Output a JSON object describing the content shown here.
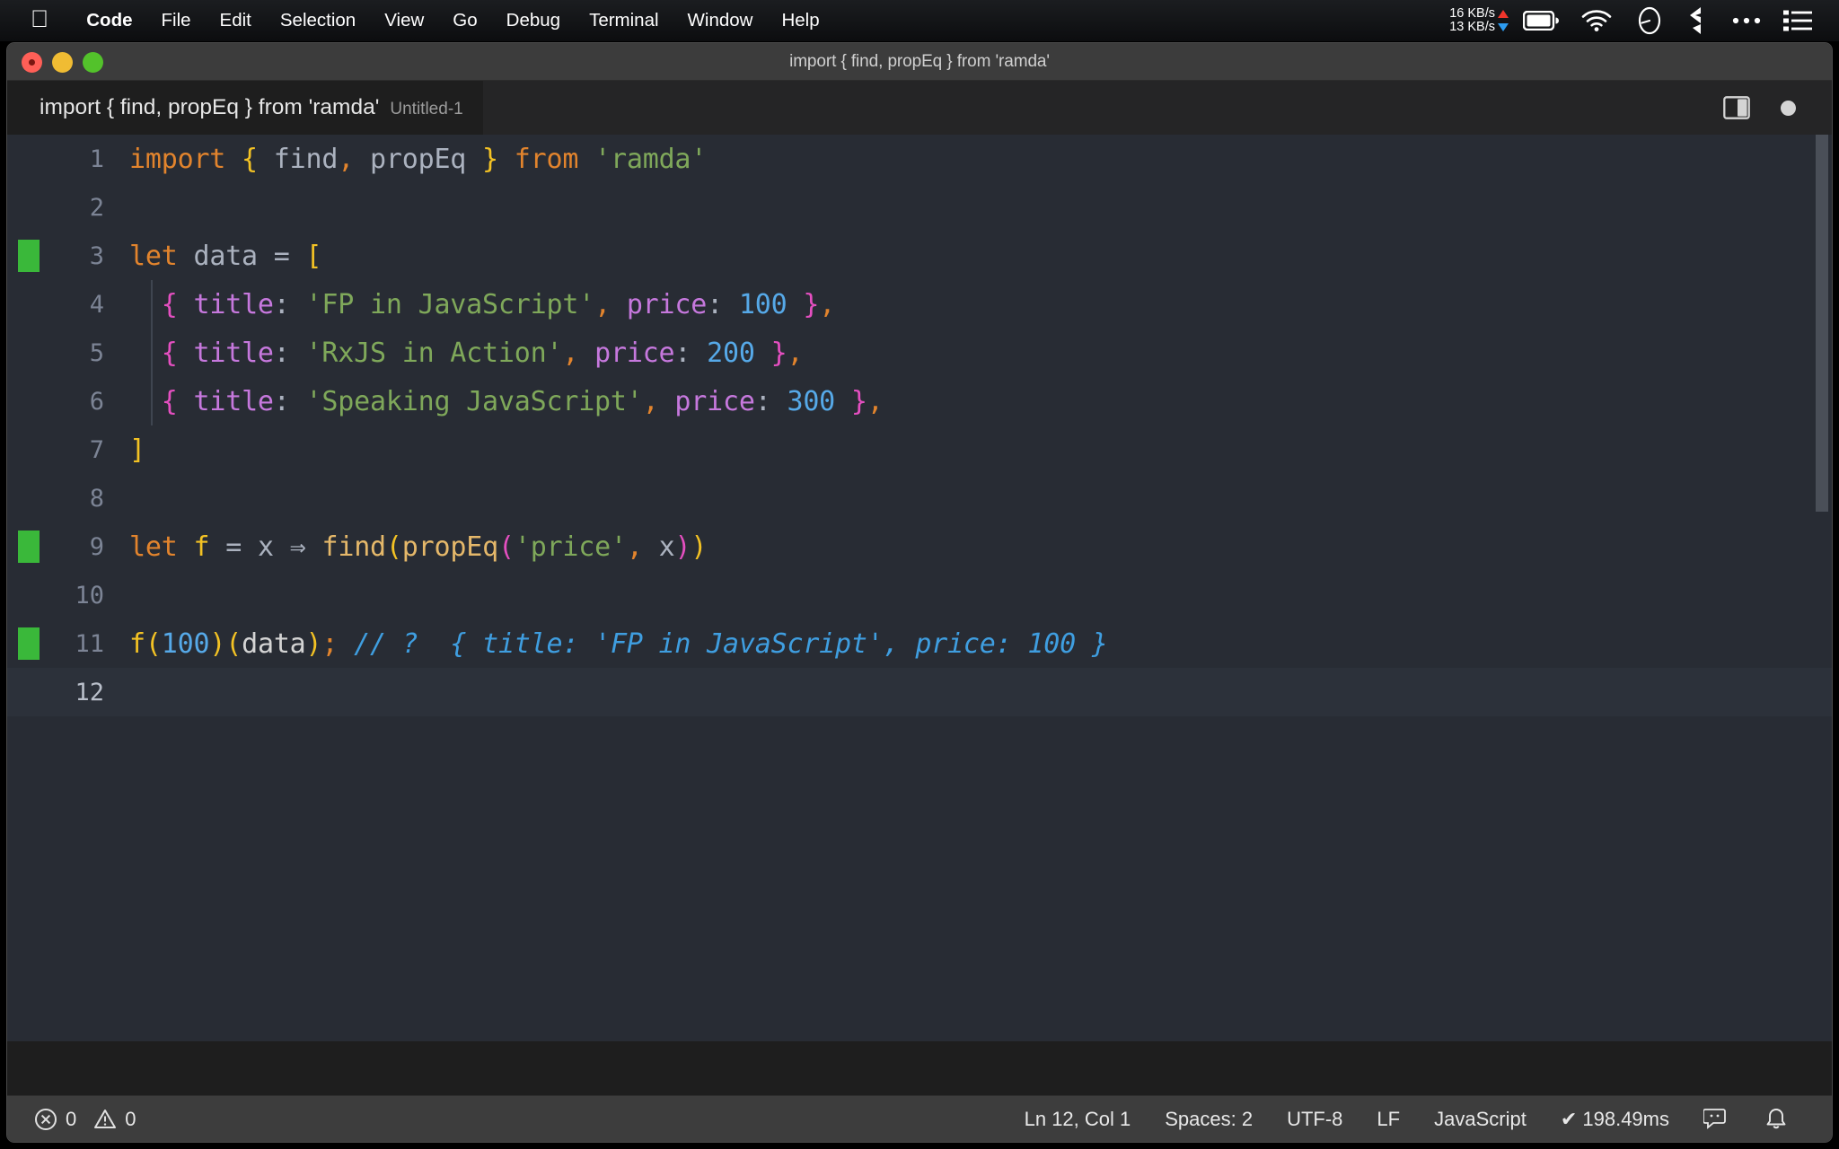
{
  "menubar": {
    "apple_icon": "apple-logo-icon",
    "items": [
      {
        "label": "Code",
        "bold": true
      },
      {
        "label": "File",
        "bold": false
      },
      {
        "label": "Edit",
        "bold": false
      },
      {
        "label": "Selection",
        "bold": false
      },
      {
        "label": "View",
        "bold": false
      },
      {
        "label": "Go",
        "bold": false
      },
      {
        "label": "Debug",
        "bold": false
      },
      {
        "label": "Terminal",
        "bold": false
      },
      {
        "label": "Window",
        "bold": false
      },
      {
        "label": "Help",
        "bold": false
      }
    ],
    "network": {
      "upload": "16 KB/s",
      "download": "13 KB/s"
    },
    "status_icons": [
      "battery-icon",
      "wifi-icon",
      "clock-icon",
      "dropbox-icon",
      "ellipsis-icon",
      "control-center-icon"
    ]
  },
  "window": {
    "title": "import { find, propEq } from 'ramda'",
    "traffic_lights": [
      "close-button",
      "minimize-button",
      "maximize-button"
    ]
  },
  "tab": {
    "name": "import { find, propEq } from 'ramda'",
    "subtitle": "Untitled-1",
    "split_editor_icon": "split-editor-icon",
    "unsaved_indicator": "unsaved-dot-icon"
  },
  "editor": {
    "line_numbers": [
      "1",
      "2",
      "3",
      "4",
      "5",
      "6",
      "7",
      "8",
      "9",
      "10",
      "11",
      "12"
    ],
    "current_line": 12,
    "git_added_lines": [
      3,
      9,
      11
    ],
    "code_lines": [
      "import { find, propEq } from 'ramda'",
      "",
      "let data = [",
      "  { title: 'FP in JavaScript', price: 100 },",
      "  { title: 'RxJS in Action', price: 200 },",
      "  { title: 'Speaking JavaScript', price: 300 },",
      "]",
      "",
      "let f = x ⇒ find(propEq('price', x))",
      "",
      "f(100)(data); // ? { title: 'FP in JavaScript', price: 100 }",
      ""
    ]
  },
  "statusbar": {
    "error_icon": "error-circle-icon",
    "error_count": "0",
    "warning_icon": "warning-triangle-icon",
    "warning_count": "0",
    "cursor_position": "Ln 12, Col 1",
    "indentation": "Spaces: 2",
    "encoding": "UTF-8",
    "eol": "LF",
    "language": "JavaScript",
    "runtime": "✔ 198.49ms",
    "feedback_icon": "feedback-smiley-icon",
    "notifications_icon": "bell-icon"
  },
  "colors": {
    "editor_bg": "#282c34",
    "tabbar_bg": "#252526",
    "titlebar_bg": "#3c3c3c",
    "statusbar_bg": "#3d3d3d",
    "git_added": "#3ab83a",
    "keyword": "#e2842d",
    "string": "#7fa85a",
    "number": "#56a9e8",
    "comment": "#3f9ee0",
    "property": "#c678dd"
  }
}
